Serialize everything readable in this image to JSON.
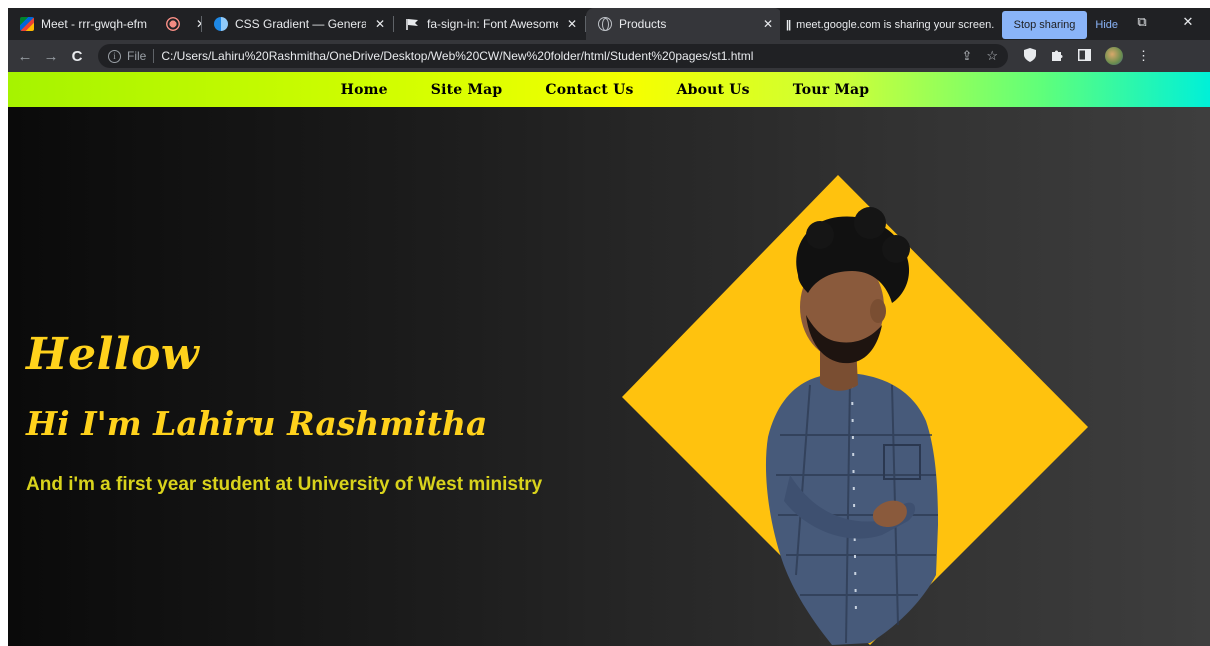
{
  "browser": {
    "tabs": [
      {
        "title": "Meet - rrr-gwqh-efm",
        "icon": "google-meet-icon",
        "close": ""
      },
      {
        "title": "",
        "icon": "recording-icon",
        "close": "✕"
      },
      {
        "title": "CSS Gradient — Generator, M",
        "icon": "css-gradient-icon",
        "close": "✕"
      },
      {
        "title": "fa-sign-in: Font Awesome Ico",
        "icon": "flag-icon",
        "close": "✕"
      },
      {
        "title": "Products",
        "icon": "globe-icon",
        "close": "✕"
      }
    ],
    "share_bar": {
      "pause": "||",
      "message": "meet.google.com is sharing your screen.",
      "stop_label": "Stop sharing",
      "hide_label": "Hide"
    },
    "window_controls": {
      "restore": "⧉",
      "close": "✕"
    },
    "toolbar": {
      "back": "←",
      "forward": "→",
      "reload": "C",
      "info": "i",
      "scheme": "File",
      "url": "C:/Users/Lahiru%20Rashmitha/OneDrive/Desktop/Web%20CW/New%20folder/html/Student%20pages/st1.html",
      "share_glyph": "⇪",
      "star_glyph": "☆",
      "menu_glyph": "⋮"
    }
  },
  "site": {
    "nav": [
      "Home",
      "Site Map",
      "Contact Us",
      "About Us",
      "Tour Map"
    ],
    "hero": {
      "greeting": "Hellow",
      "intro": "Hi I'm Lahiru Rashmitha",
      "subtitle": "And i'm a first year student at University of West ministry"
    }
  },
  "colors": {
    "accent_yellow": "#ffd21c",
    "diamond": "#ffc20e",
    "subtitle": "#d9d31c",
    "share_button": "#8ab4f8"
  }
}
